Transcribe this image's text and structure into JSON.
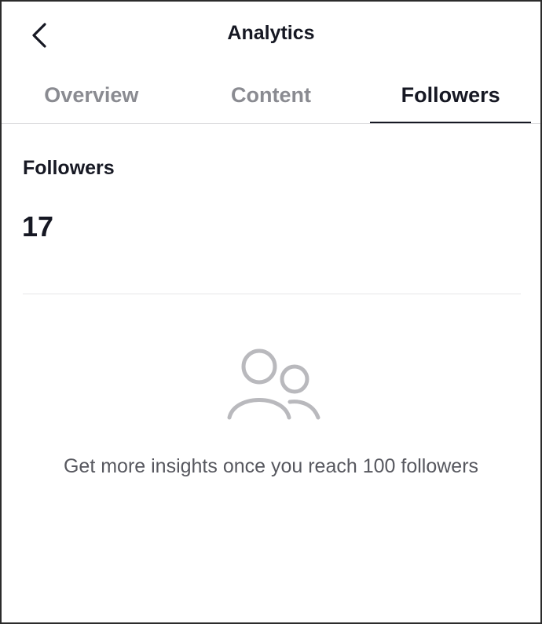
{
  "header": {
    "title": "Analytics",
    "back_icon": "chevron-left-icon"
  },
  "tabs": [
    {
      "label": "Overview",
      "active": false
    },
    {
      "label": "Content",
      "active": false
    },
    {
      "label": "Followers",
      "active": true
    }
  ],
  "followers": {
    "label": "Followers",
    "count": "17"
  },
  "empty_state": {
    "icon": "followers-icon",
    "message": "Get more insights once you reach 100 followers"
  },
  "colors": {
    "text_primary": "#161823",
    "text_muted": "#8a8b91",
    "icon_gray": "#b9b9bd"
  }
}
